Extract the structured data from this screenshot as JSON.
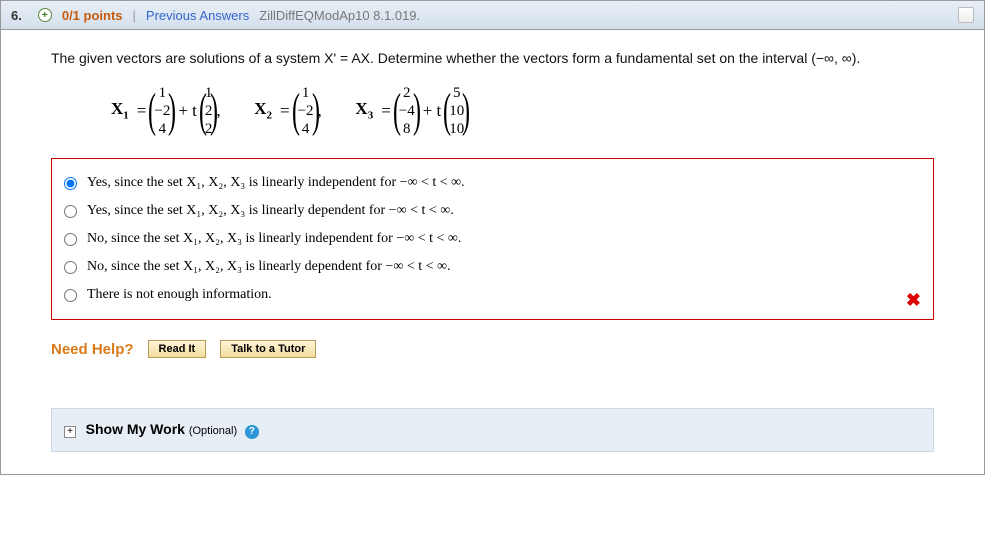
{
  "header": {
    "question_number": "6.",
    "plus_glyph": "+",
    "points": "0/1 points",
    "separator": "|",
    "prev_answers": "Previous Answers",
    "source": "ZillDiffEQModAp10 8.1.019."
  },
  "prompt": {
    "line1": "The given vectors are solutions of a system  X' = AX.  Determine whether the vectors form a fundamental set on the interval  (−∞, ∞)."
  },
  "vectors": {
    "x1": {
      "label": "X",
      "sublabel": "1",
      "col1": [
        "1",
        "−2",
        "4"
      ],
      "plus_t": "+ t",
      "col2": [
        "1",
        "2",
        "2"
      ]
    },
    "x2": {
      "label": "X",
      "sublabel": "2",
      "col1": [
        "1",
        "−2",
        "4"
      ]
    },
    "x3": {
      "label": "X",
      "sublabel": "3",
      "col1": [
        "2",
        "−4",
        "8"
      ],
      "plus_t": "+ t",
      "col2": [
        "5",
        "10",
        "10"
      ]
    }
  },
  "choices": {
    "c1": "Yes, since the set X₁, X₂, X₃ is linearly independent for  −∞ < t < ∞.",
    "c2": "Yes, since the set X₁, X₂, X₃ is linearly dependent for  −∞ < t < ∞.",
    "c3": "No, since the set X₁, X₂, X₃ is linearly independent for  −∞ < t < ∞.",
    "c4": "No, since the set X₁, X₂, X₃ is linearly dependent for  −∞ < t < ∞.",
    "c5": "There is not enough information.",
    "x_mark": "✖"
  },
  "need_help": {
    "label": "Need Help?",
    "read_it": "Read It",
    "tutor": "Talk to a Tutor"
  },
  "smw": {
    "expand": "+",
    "label": "Show My Work ",
    "optional": "(Optional)",
    "q": "?"
  }
}
